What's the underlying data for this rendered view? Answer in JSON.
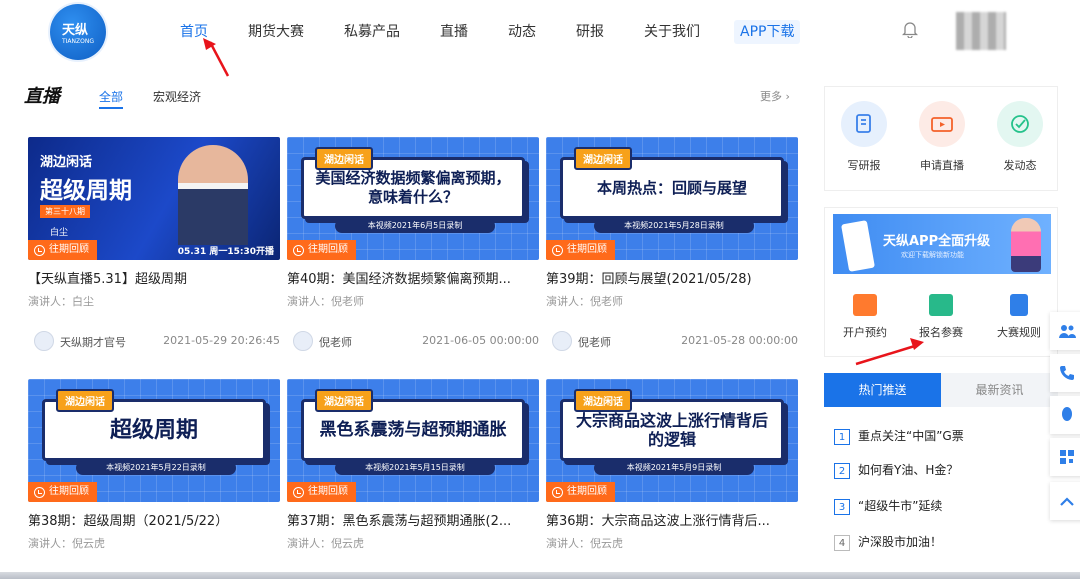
{
  "logo": {
    "main": "天纵",
    "sub": "TIANZONG"
  },
  "nav": {
    "items": [
      "首页",
      "期货大赛",
      "私募产品",
      "直播",
      "动态",
      "研报",
      "关于我们"
    ],
    "app": "APP下载"
  },
  "section": {
    "title": "直播",
    "tabs": [
      "全部",
      "宏观经济"
    ],
    "more": "更多 ›"
  },
  "replay_label": "往期回顾",
  "speaker_prefix": "演讲人：",
  "cards": [
    {
      "title": "【天纵直播5.31】超级周期",
      "speaker": "演讲人：白尘",
      "author": "天纵期才官号",
      "time": "2021-05-29 20:26:45",
      "thumb": {
        "t1": "湖边闲话",
        "t2": "超级周期",
        "t3": "第三十八期",
        "t4": "白尘",
        "t5": "05.31  周一15:30开播"
      }
    },
    {
      "title": "第40期：美国经济数据频繁偏离预期...",
      "speaker": "演讲人：倪老师",
      "author": "倪老师",
      "time": "2021-06-05 00:00:00",
      "thumb": {
        "tag": "湖边闲话",
        "headline": "美国经济数据频繁偏离预期，意味着什么？",
        "sub": "本视频2021年6月5日录制"
      }
    },
    {
      "title": "第39期：回顾与展望(2021/05/28)",
      "speaker": "演讲人：倪老师",
      "author": "倪老师",
      "time": "2021-05-28 00:00:00",
      "thumb": {
        "tag": "湖边闲话",
        "headline": "本周热点：回顾与展望",
        "sub": "本视频2021年5月28日录制"
      }
    },
    {
      "title": "第38期：超级周期（2021/5/22）",
      "speaker": "演讲人：倪云虎",
      "thumb": {
        "tag": "湖边闲话",
        "headline": "超级周期",
        "sub": "本视频2021年5月22日录制"
      }
    },
    {
      "title": "第37期：黑色系震荡与超预期通胀(2...",
      "speaker": "演讲人：倪云虎",
      "thumb": {
        "tag": "湖边闲话",
        "headline": "黑色系震荡与超预期通胀",
        "sub": "本视频2021年5月15日录制"
      }
    },
    {
      "title": "第36期：大宗商品这波上涨行情背后...",
      "speaker": "演讲人：倪云虎",
      "thumb": {
        "tag": "湖边闲话",
        "headline": "大宗商品这波上涨行情背后的逻辑",
        "sub": "本视频2021年5月9日录制"
      }
    }
  ],
  "quick": [
    "写研报",
    "申请直播",
    "发动态"
  ],
  "app_banner": {
    "headline": "天纵APP全面升级",
    "sub": "欢迎下载解锁新功能"
  },
  "services": [
    "开户预约",
    "报名参赛",
    "大赛规则"
  ],
  "news": {
    "tabs": [
      "热门推送",
      "最新资讯"
    ],
    "items": [
      "重点关注“中国”G票",
      "如何看Y油、H金？",
      "“超级牛市”延续",
      "沪深股市加油！"
    ]
  },
  "colors": {
    "accent": "#1a73e8",
    "replay": "#ff6a1a",
    "arrow": "#e8141b"
  }
}
